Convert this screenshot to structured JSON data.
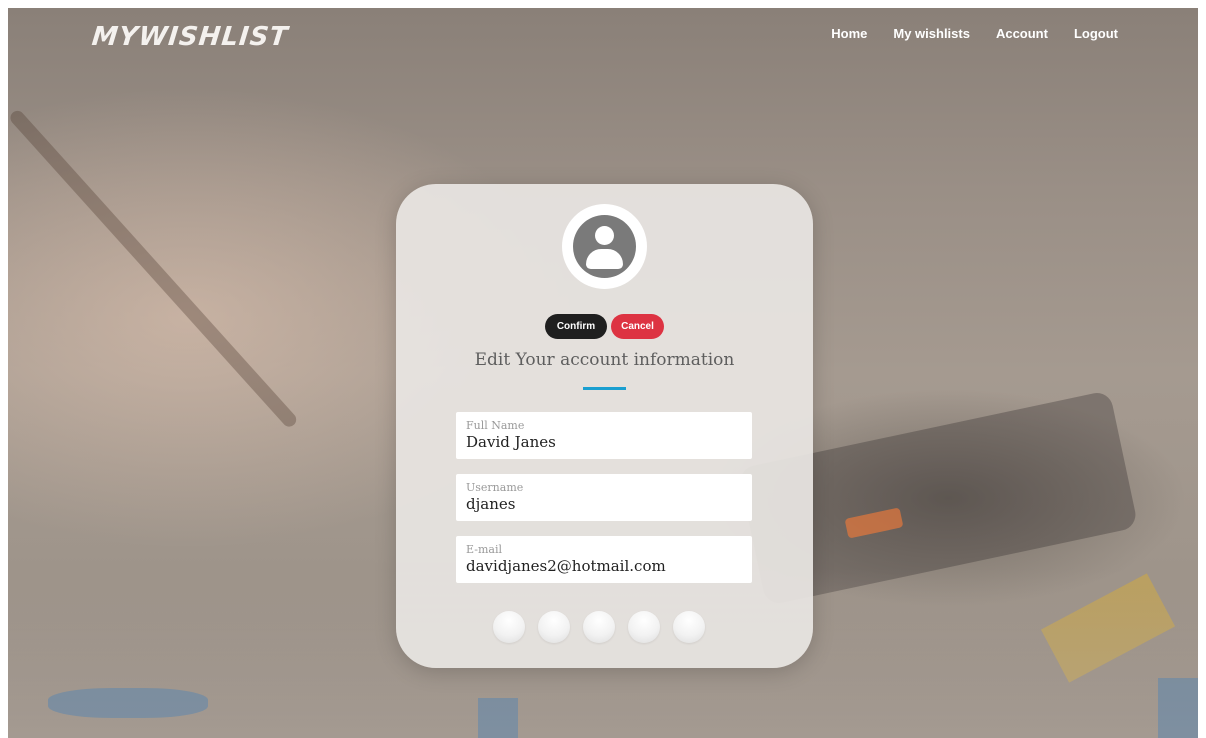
{
  "brand": {
    "logo": "MYWISHLIST"
  },
  "nav": {
    "items": [
      "Home",
      "My wishlists",
      "Account",
      "Logout"
    ]
  },
  "profile": {
    "buttons": {
      "confirm": "Confirm",
      "cancel": "Cancel"
    },
    "heading": "Edit Your account information",
    "fields": [
      {
        "label": "Full Name",
        "value": "David Janes"
      },
      {
        "label": "Username",
        "value": "djanes"
      },
      {
        "label": "E-mail",
        "value": "davidjanes2@hotmail.com"
      }
    ]
  },
  "colors": {
    "accent": "#1a9fd0",
    "confirm": "#1f1f1f",
    "cancel": "#dd3342"
  },
  "icons": {
    "avatar": "user-circle-icon"
  }
}
